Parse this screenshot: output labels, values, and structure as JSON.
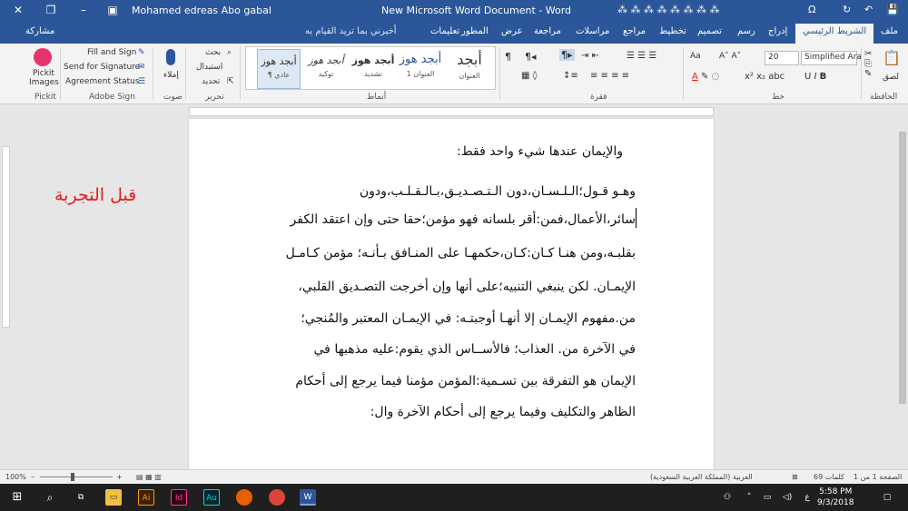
{
  "titlebar": {
    "title": "New Microsoft Word Document  -  Word",
    "user": "Mohamed edreas Abo gabal",
    "colors": {
      "bg": "#2b579a"
    }
  },
  "tabs": {
    "file": "ملف",
    "home": "الشريط الرئيسي",
    "insert": "إدراج",
    "draw": "رسم",
    "design": "تصميم",
    "layout": "تخطيط",
    "references": "مراجع",
    "mailings": "مراسلات",
    "review": "مراجعة",
    "view": "عرض",
    "developer": "المطور",
    "help": "تعليمات",
    "tell_me": "أخبرني بما تريد القيام به",
    "share": "مشاركة"
  },
  "ribbon": {
    "clipboard": {
      "label": "الحافظة",
      "paste": "لصق"
    },
    "font": {
      "label": "خط",
      "name": "Simplified Ara",
      "size": "20"
    },
    "paragraph": {
      "label": "فقرة"
    },
    "styles": {
      "label": "أنماط",
      "items": [
        {
          "preview": "أبجد هوز",
          "name": "¶ عادي"
        },
        {
          "preview": "أبجد هوز",
          "name": "توكيد"
        },
        {
          "preview": "أبجد هوز",
          "name": "تشديد"
        },
        {
          "preview": "أبجد هوز",
          "name": "العنوان 1"
        },
        {
          "preview": "أبجد",
          "name": "العنوان"
        }
      ]
    },
    "editing": {
      "label": "تحرير",
      "find": "بحث",
      "replace": "استبدال",
      "select": "تحديد"
    },
    "voice": {
      "label": "صوت",
      "dictate": "إملاء"
    },
    "adobe": {
      "label": "Adobe Sign",
      "fill_sign": "Fill and Sign",
      "send_sig": "Send for Signature",
      "agreement": "Agreement Status"
    },
    "pickit": {
      "label": "Pickit",
      "button": "Pickit Images"
    }
  },
  "document": {
    "lines": [
      "والإيمان عندها شيء واحد فقط:",
      "وهـو  قـول؛الـلـسـان،دون  الـتـصـديـق،بـالـقـلـب،ودون",
      "سائر،الأعمال،فمن:أقر بلسانه فهو مؤمن؛حقا حتى وإن اعتقد الكفر",
      "بقلبـه،ومن هنـا كـان:كـان،حكمهـا على المنـافق بـأنـه؛ مؤمن كـامـل",
      "الإيمـان. لكن ينبغي التنبيه؛على أنها وإن أخرجت التصـديق القلبي،",
      "من.مفهوم الإيمـان إلا أنهـا أوجبتـه: في الإيمـان المعتبر والمُنجي؛",
      "في الآخرة من. العذاب؛ فالأســاس الذي يقوم:عليه مذهبها في",
      "الإيمان هو التفرقة بين تسـمية:المؤمن مؤمنا فيما يرجع إلى أحكام",
      "الظاهر والتكليف وفيما يرجع إلى أحكام الآخرة وال:"
    ]
  },
  "annotation": {
    "text": "قبل التجربة",
    "color": "#e41b1b"
  },
  "statusbar": {
    "page": "الصفحة 1 من 1",
    "words": "69 كلمات",
    "language": "العربية (المملكة العربية السعودية)",
    "zoom": "100%"
  },
  "taskbar": {
    "time": "5:58 PM",
    "date": "9/3/2018",
    "lang": "ع"
  }
}
